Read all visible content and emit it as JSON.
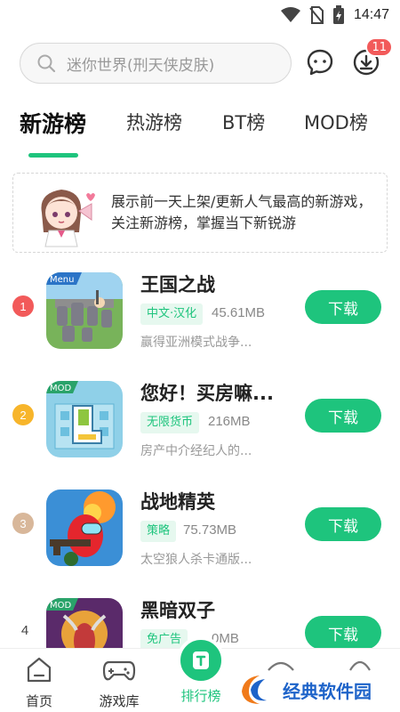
{
  "status_bar": {
    "time": "14:47"
  },
  "search": {
    "placeholder": "迷你世界(刑天侠皮肤)"
  },
  "header": {
    "download_badge": "11"
  },
  "tabs": [
    {
      "label": "新游榜",
      "active": true
    },
    {
      "label": "热游榜",
      "active": false
    },
    {
      "label": "BT榜",
      "active": false
    },
    {
      "label": "MOD榜",
      "active": false
    }
  ],
  "banner": {
    "text": "展示前一天上架/更新人气最高的新游戏，关注新游榜，掌握当下新锐游"
  },
  "games": [
    {
      "rank": "1",
      "rank_color": "#f25a5a",
      "name": "王国之战",
      "tag": "中文·汉化",
      "size": "45.61MB",
      "desc": "赢得亚洲模式战争...",
      "icon_label": "Menu",
      "button": "下载"
    },
    {
      "rank": "2",
      "rank_color": "#f7b52b",
      "name": "您好！买房嘛...",
      "tag": "无限货币",
      "size": "216MB",
      "desc": "房产中介经纪人的...",
      "icon_label": "MOD",
      "button": "下载"
    },
    {
      "rank": "3",
      "rank_color": "#d8b79a",
      "name": "战地精英",
      "tag": "策略",
      "size": "75.73MB",
      "desc": "太空狼人杀卡通版...",
      "icon_label": "",
      "button": "下载"
    },
    {
      "rank": "4",
      "rank_color": "",
      "name": "黑暗双子",
      "tag": "免广告",
      "size": "0MB",
      "desc": "",
      "icon_label": "MOD",
      "button": "下载"
    }
  ],
  "bottom_nav": [
    {
      "label": "首页"
    },
    {
      "label": "游戏库"
    },
    {
      "label": "排行榜",
      "active": true
    }
  ],
  "watermark": {
    "text": "经典软件园"
  },
  "colors": {
    "accent": "#1ec47d",
    "badge": "#f25a5a",
    "watermark": "#1d63c9"
  }
}
